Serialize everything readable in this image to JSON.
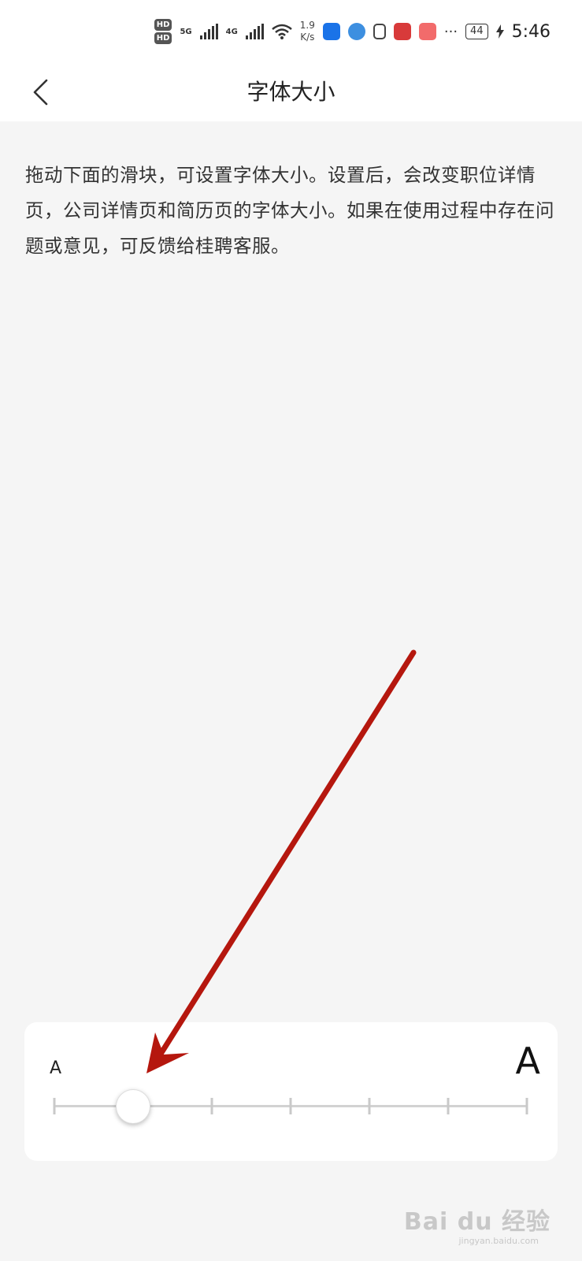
{
  "status_bar": {
    "hd1": "HD",
    "hd2": "HD",
    "net1": "5G",
    "net2": "4G",
    "speed_value": "1.9",
    "speed_unit": "K/s",
    "more": "···",
    "battery": "44",
    "time": "5:46"
  },
  "header": {
    "title": "字体大小"
  },
  "description": "拖动下面的滑块，可设置字体大小。设置后，会改变职位详情页，公司详情页和简历页的字体大小。如果在使用过程中存在问题或意见，可反馈给桂聘客服。",
  "slider": {
    "small_label": "A",
    "large_label": "A",
    "steps": 7,
    "selected_index": 1
  },
  "watermark": {
    "text": "Bai du 经验",
    "sub": "jingyan.baidu.com"
  },
  "colors": {
    "arrow": "#b5170e",
    "background": "#f5f5f5"
  }
}
